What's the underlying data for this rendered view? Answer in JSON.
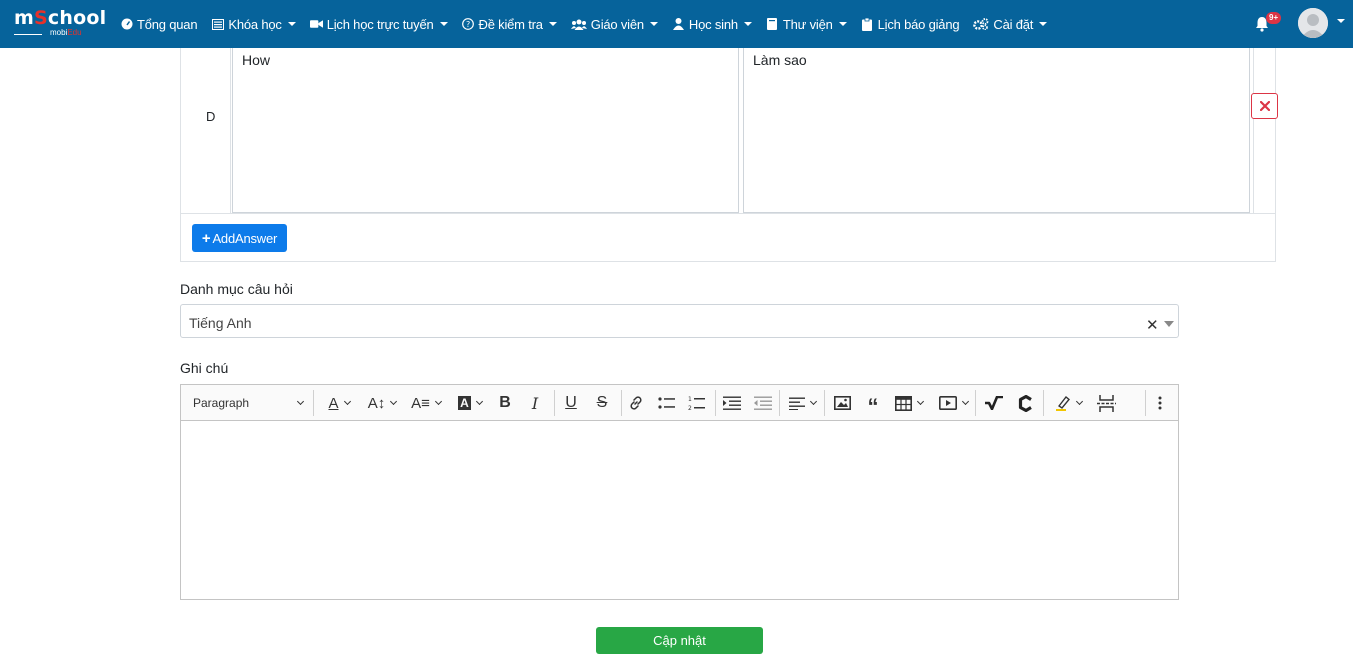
{
  "brand": {
    "logo_main_1": "m",
    "logo_main_o": "S",
    "logo_main_2": "chool",
    "logo_sub_1": "mobi",
    "logo_sub_2": "Edu"
  },
  "nav": {
    "items": [
      {
        "label": "Tổng quan",
        "icon": "dashboard-icon",
        "caret": false
      },
      {
        "label": "Khóa học",
        "icon": "list-icon",
        "caret": true
      },
      {
        "label": "Lịch học trực tuyến",
        "icon": "video-icon",
        "caret": true
      },
      {
        "label": "Đề kiểm tra",
        "icon": "question-icon",
        "caret": true
      },
      {
        "label": "Giáo viên",
        "icon": "users-icon",
        "caret": true
      },
      {
        "label": "Học sinh",
        "icon": "user-icon",
        "caret": true
      },
      {
        "label": "Thư viện",
        "icon": "book-icon",
        "caret": true
      },
      {
        "label": "Lịch báo giảng",
        "icon": "clipboard-icon",
        "caret": false
      },
      {
        "label": "Cài đặt",
        "icon": "gears-icon",
        "caret": true
      }
    ],
    "notification_badge": "9+"
  },
  "answer": {
    "label": "D",
    "text_en": "How",
    "text_vi": "Làm sao",
    "add_button": "AddAnswer"
  },
  "category": {
    "label": "Danh mục câu hỏi",
    "value": "Tiếng Anh"
  },
  "note": {
    "label": "Ghi chú",
    "paragraph_select": "Paragraph"
  },
  "submit_label": "Cập nhật",
  "colors": {
    "navbar": "#06639b",
    "primary": "#0d7bea",
    "success": "#28a745",
    "danger": "#dc3545"
  }
}
